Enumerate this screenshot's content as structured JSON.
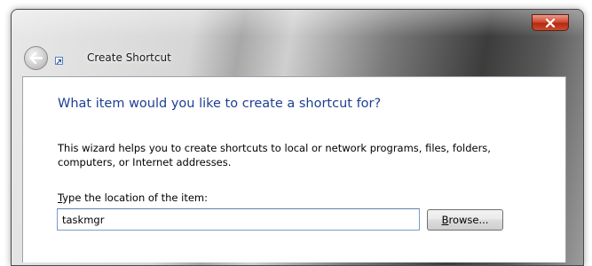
{
  "window": {
    "title": "Create Shortcut"
  },
  "titlebar": {
    "back_icon": "back-arrow-icon",
    "app_icon": "shortcut-icon",
    "close_icon": "close-icon"
  },
  "wizard": {
    "heading": "What item would you like to create a shortcut for?",
    "description": "This wizard helps you to create shortcuts to local or network programs, files, folders, computers, or Internet addresses.",
    "location_label_accel": "T",
    "location_label_rest": "ype the location of the item:",
    "location_value": "taskmgr",
    "browse_accel": "B",
    "browse_rest": "rowse..."
  },
  "colors": {
    "heading": "#1e3f92",
    "close_button": "#c84a2f"
  }
}
